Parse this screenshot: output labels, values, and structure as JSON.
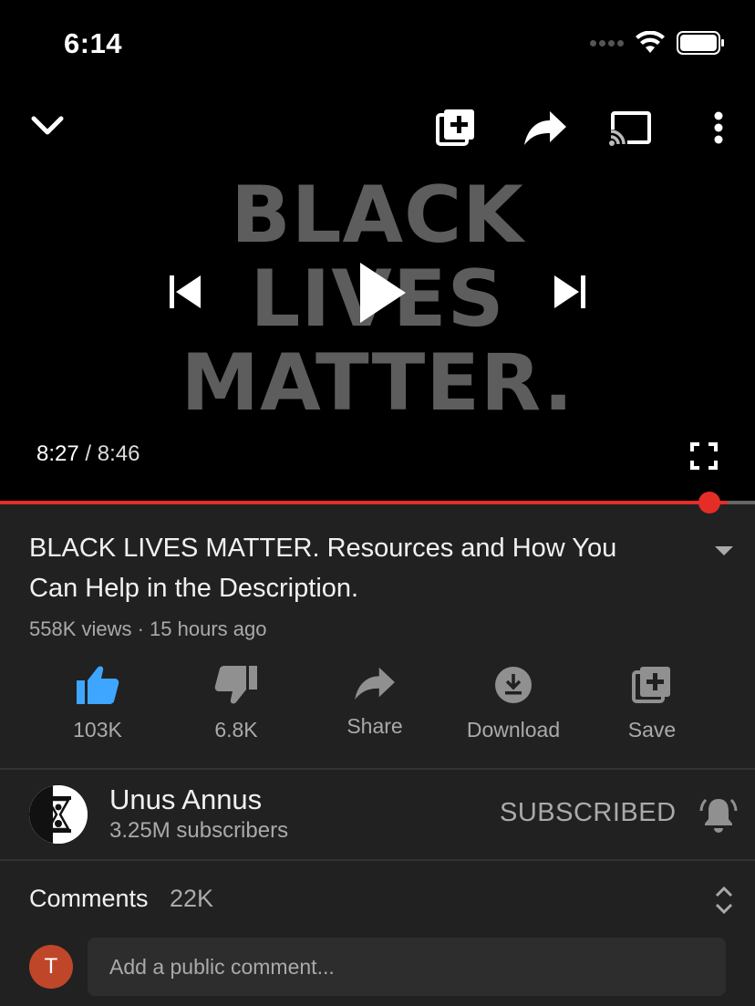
{
  "status_bar": {
    "time": "6:14"
  },
  "player": {
    "art_lines": [
      "BLACK",
      "LIVES",
      "MATTER."
    ],
    "current_time": "8:27",
    "separator": "/",
    "total_time": "8:46",
    "progress_fraction": 0.964
  },
  "video": {
    "title": "BLACK LIVES MATTER. Resources and How You Can Help in the Description.",
    "meta": "558K views · 15 hours ago"
  },
  "actions": {
    "like": "103K",
    "dislike": "6.8K",
    "share": "Share",
    "download": "Download",
    "save": "Save"
  },
  "channel": {
    "name": "Unus Annus",
    "subscribers": "3.25M subscribers",
    "subscribe_label": "SUBSCRIBED"
  },
  "comments": {
    "heading": "Comments",
    "count": "22K",
    "user_initial": "T",
    "placeholder": "Add a public comment..."
  },
  "colors": {
    "accent_red": "#e52d27",
    "like_blue": "#3ea6ff",
    "avatar_orange": "#c0462a"
  }
}
